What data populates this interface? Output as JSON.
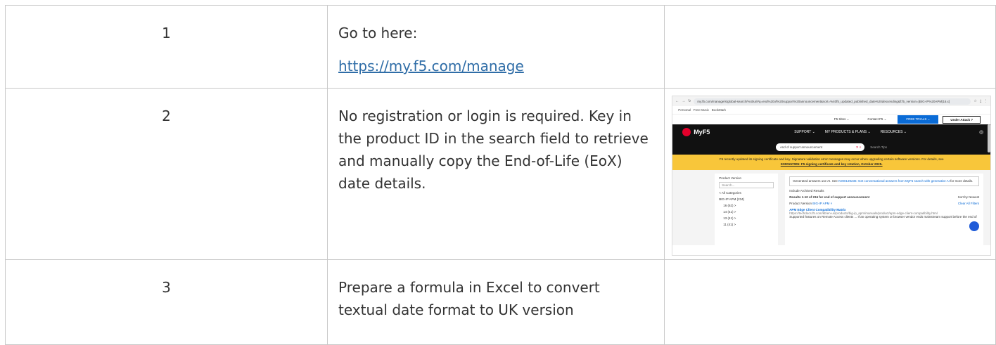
{
  "rows": [
    {
      "number": "1",
      "lines": [
        "Go to here:"
      ],
      "link": "https://my.f5.com/manage"
    },
    {
      "number": "2",
      "text": "No registration or login is required. Key in the product ID in the search field to retrieve and manually copy the End-of-Life (EoX) date details.",
      "screenshot": {
        "url": "my.f5.com/manage/s/global-search/%40uri#q=end%20of%20support%20announcement&sort=%40f5_updated_published_date%20descending&f:f5_version=[BIG-IP%20APM|16.x]",
        "bookmarks": [
          "Personal",
          "Free Music",
          "BookMark"
        ],
        "topnav": {
          "f5_sites": "F5 Sites ⌄",
          "contact": "Contact F5 ⌄",
          "free_trials": "FREE TRIALS ⌄",
          "under_attack": "Under Attack ?"
        },
        "brand": "MyF5",
        "mainnav": [
          "SUPPORT ⌄",
          "MY PRODUCTS & PLANS ⌄",
          "RESOURCES ⌄"
        ],
        "search_value": "end of support announcement",
        "search_tips": "Search Tips",
        "banner_text": "F5 recently updated its signing certificate and key. Signature validation error messages may occur when upgrading certain software versions. For details, see",
        "banner_link": "K000157005: F5 signing certificate and key rotation, October 2025.",
        "filter": {
          "title": "Product Version",
          "search_placeholder": "Search...",
          "all_categories": "< All Categories",
          "product": "BIG-IP APM (234)",
          "versions": [
            "16 (62) >",
            "14 (41) >",
            "13 (41) >",
            "11 (41) >"
          ]
        },
        "ai_notice": "Generated answers use AI. See",
        "ai_link": "K000139236: Get conversational answers from MyF5 search with generative AI",
        "ai_more": "for more details.",
        "include_archived": "Include Archived Results",
        "results_count": "Results 1-10 of 234 for end of support announcement",
        "sort_label": "Sort by",
        "sort_value": "Newest",
        "product_version_label": "Product Version",
        "product_version_chip": "BIG-IP APM ×",
        "clear_filters": "Clear All Filters",
        "result_title": "APM Edge Client Compatibility Matrix",
        "result_url": "https://techdocs.f5.com/kb/en-us/products/big-ip_apm/manuals/product/apm-edge-client-compatibility.html",
        "result_snippet": "Supported features on Remote Access clients ... If an operating system or browser vendor ends mainstream support before the end of"
      }
    },
    {
      "number": "3",
      "lines": [
        "Prepare a formula in Excel to convert",
        "textual date format to UK version"
      ]
    }
  ]
}
